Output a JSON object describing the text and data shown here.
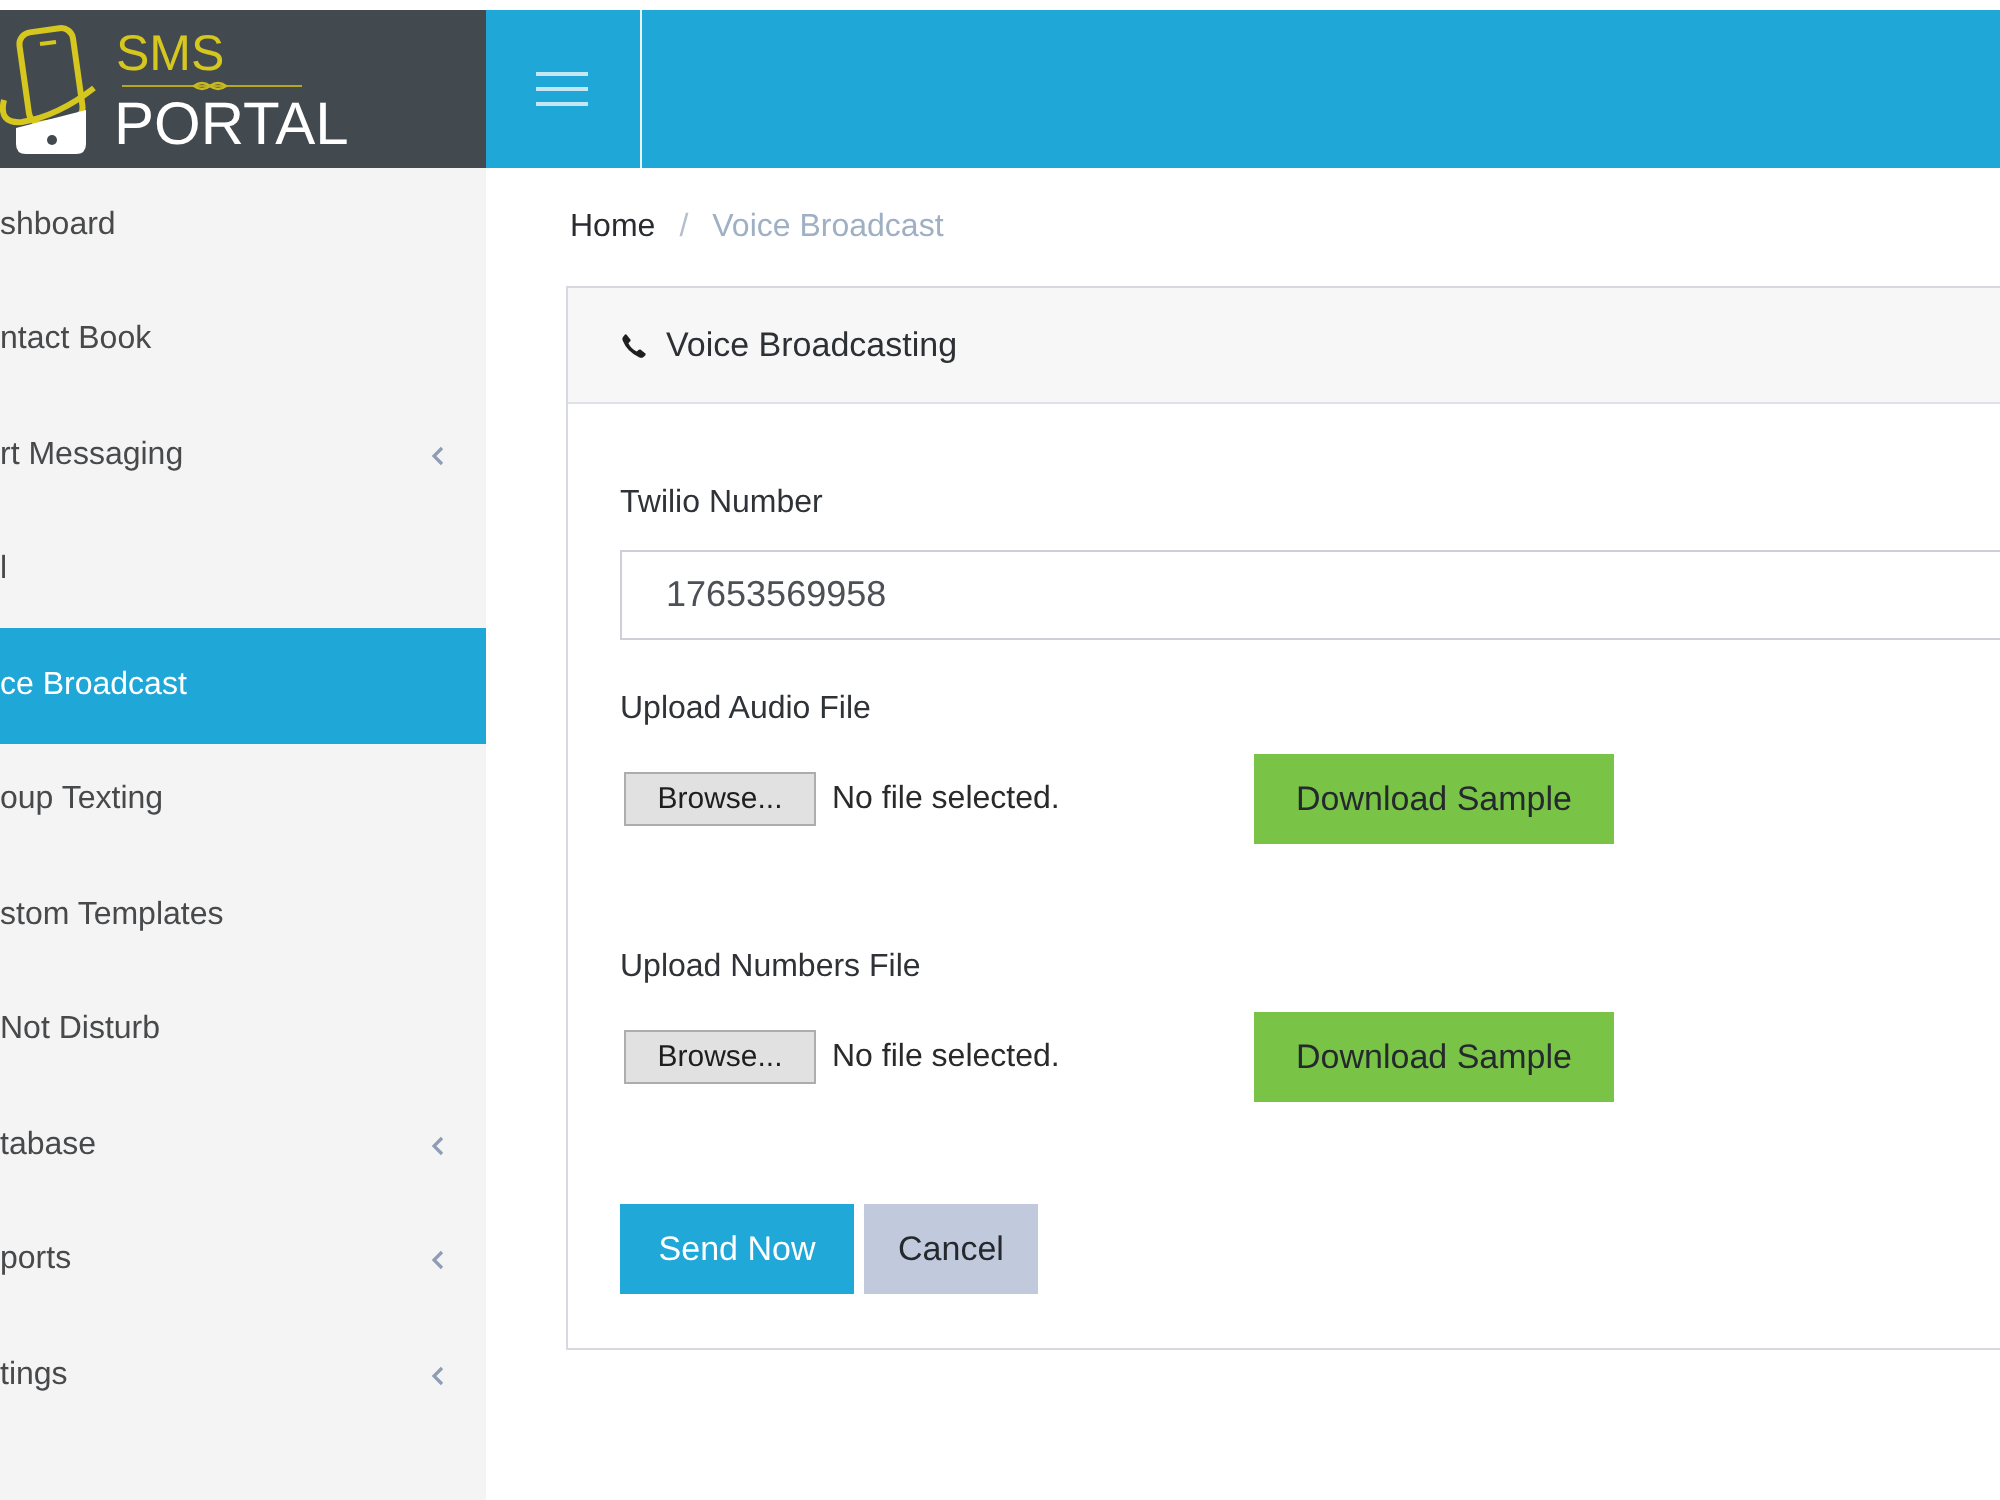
{
  "header": {
    "logo": {
      "top": "SMS",
      "bottom": "PORTAL"
    }
  },
  "sidebar": {
    "items": [
      {
        "label": "shboard",
        "selected": false,
        "submenu": false
      },
      {
        "label": "ntact Book",
        "selected": false,
        "submenu": false
      },
      {
        "label": "rt Messaging",
        "selected": false,
        "submenu": true
      },
      {
        "label": "l",
        "selected": false,
        "submenu": false
      },
      {
        "label": "ce Broadcast",
        "selected": true,
        "submenu": false
      },
      {
        "label": "oup Texting",
        "selected": false,
        "submenu": false
      },
      {
        "label": "stom Templates",
        "selected": false,
        "submenu": false
      },
      {
        "label": "Not Disturb",
        "selected": false,
        "submenu": false
      },
      {
        "label": "tabase",
        "selected": false,
        "submenu": true
      },
      {
        "label": "ports",
        "selected": false,
        "submenu": true
      },
      {
        "label": "tings",
        "selected": false,
        "submenu": true
      }
    ]
  },
  "breadcrumb": {
    "separator": "/",
    "items": [
      {
        "label": "Home",
        "current": false
      },
      {
        "label": "Voice Broadcast",
        "current": true
      }
    ]
  },
  "card": {
    "title": "Voice Broadcasting",
    "fields": [
      {
        "kind": "text",
        "label": "Twilio Number",
        "value": "17653569958"
      },
      {
        "kind": "file",
        "label": "Upload Audio File",
        "button": "Browse...",
        "status": "No file selected.",
        "action": "Download Sample"
      },
      {
        "kind": "file",
        "label": "Upload Numbers File",
        "button": "Browse...",
        "status": "No file selected.",
        "action": "Download Sample"
      }
    ],
    "buttons": [
      {
        "kind": "primary",
        "label": "Send Now"
      },
      {
        "kind": "secondary",
        "label": "Cancel"
      }
    ]
  }
}
